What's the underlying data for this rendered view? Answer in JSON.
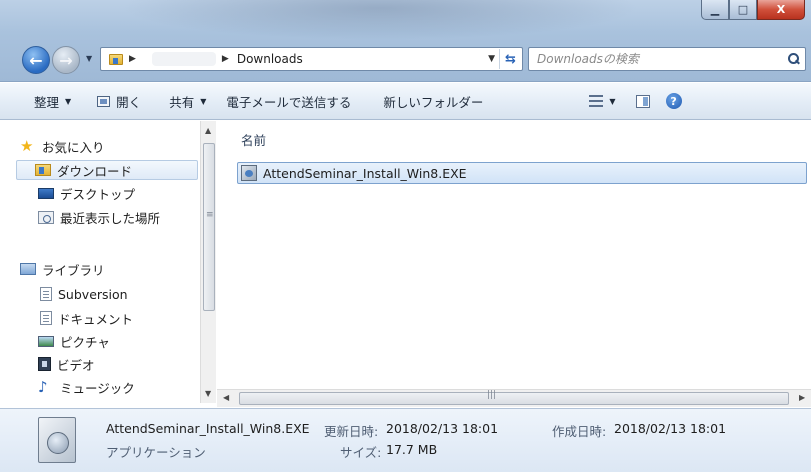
{
  "window": {
    "buttons": {
      "minimize": "▁",
      "maximize": "□",
      "close": "X"
    }
  },
  "address": {
    "blurred_segment": "",
    "current_folder": "Downloads"
  },
  "search": {
    "placeholder": "Downloadsの検索"
  },
  "toolbar": {
    "organize": "整理",
    "open": "開く",
    "share": "共有",
    "email": "電子メールで送信する",
    "new_folder": "新しいフォルダー",
    "help": "?"
  },
  "navigation": {
    "favorites": "お気に入り",
    "downloads": "ダウンロード",
    "desktop": "デスクトップ",
    "recent": "最近表示した場所",
    "libraries": "ライブラリ",
    "subversion": "Subversion",
    "documents": "ドキュメント",
    "pictures": "ピクチャ",
    "videos": "ビデオ",
    "music": "ミュージック"
  },
  "content": {
    "column_name": "名前",
    "files": [
      {
        "name": "AttendSeminar_Install_Win8.EXE",
        "icon": "exe-icon",
        "selected": true
      }
    ]
  },
  "details": {
    "filename": "AttendSeminar_Install_Win8.EXE",
    "type": "アプリケーション",
    "modified_label": "更新日時:",
    "modified_value": "2018/02/13 18:01",
    "size_label": "サイズ:",
    "size_value": "17.7 MB",
    "created_label": "作成日時:",
    "created_value": "2018/02/13 18:01"
  },
  "colors": {
    "selection_border": "#7da2ce",
    "toolbar_top": "#f5f9fd",
    "glass": "#a9c2dd"
  }
}
